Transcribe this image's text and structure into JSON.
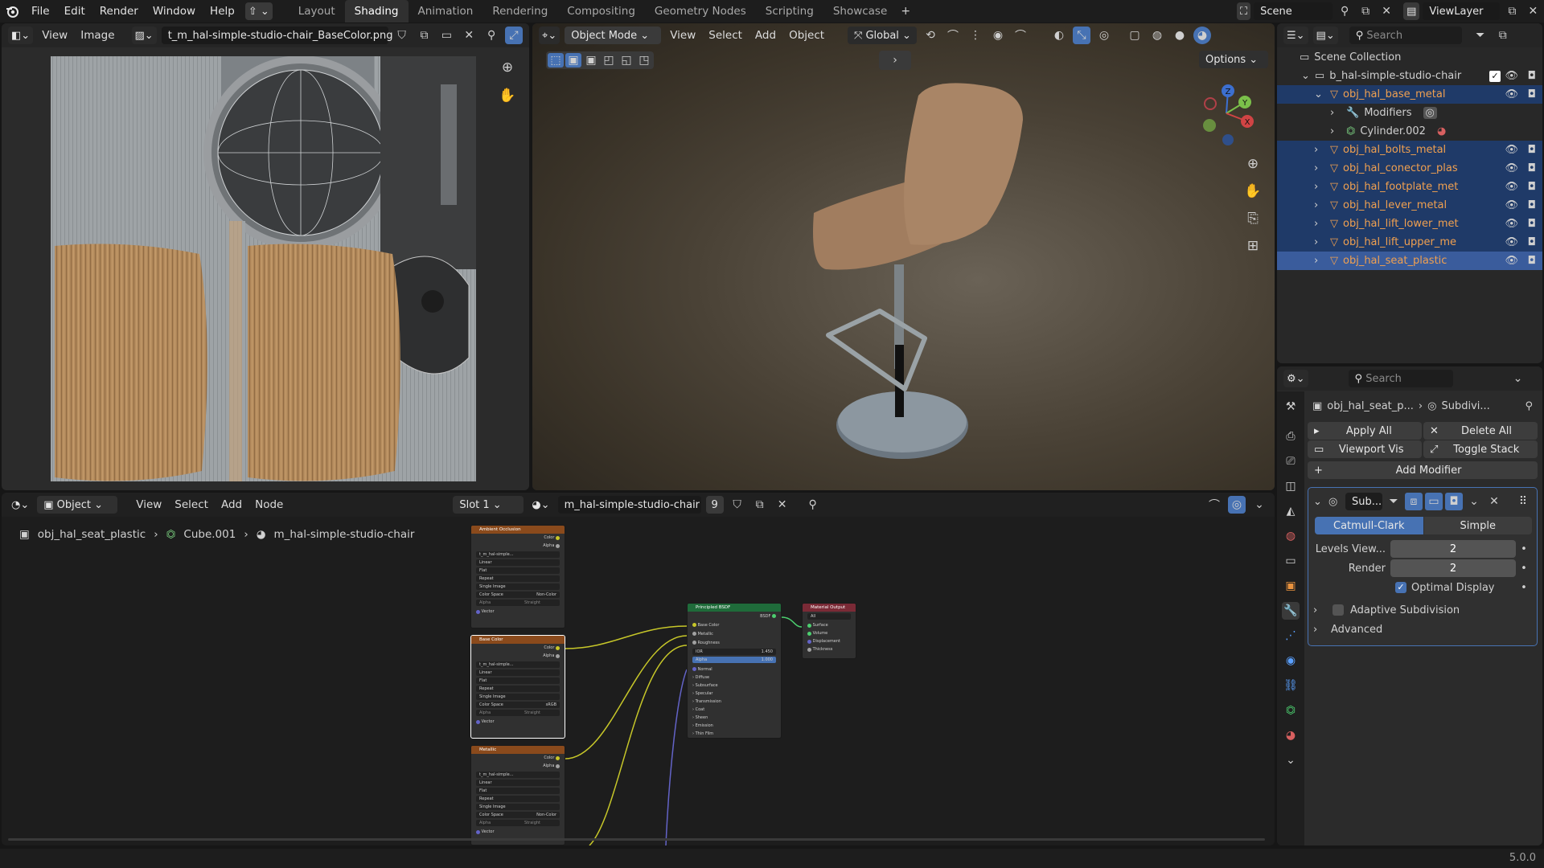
{
  "topbar": {
    "menus": [
      "File",
      "Edit",
      "Render",
      "Window",
      "Help"
    ],
    "workspaces": [
      "Layout",
      "Shading",
      "Animation",
      "Rendering",
      "Compositing",
      "Geometry Nodes",
      "Scripting",
      "Showcase"
    ],
    "active_workspace": "Shading",
    "scene": "Scene",
    "view_layer": "ViewLayer"
  },
  "image_editor": {
    "menus": [
      "View",
      "Image"
    ],
    "image_name": "t_m_hal-simple-studio-chair_BaseColor.png"
  },
  "viewport": {
    "mode": "Object Mode",
    "menus": [
      "View",
      "Select",
      "Add",
      "Object"
    ],
    "transform_orientation": "Global",
    "options_label": "Options",
    "gizmo_axes": [
      "Z",
      "Y",
      "X"
    ]
  },
  "outliner": {
    "search_placeholder": "Search",
    "scene_collection": "Scene Collection",
    "collection": "b_hal-simple-studio-chair",
    "items": [
      {
        "name": "obj_hal_base_metal",
        "level": 1,
        "expanded": true,
        "selected": true
      },
      {
        "name": "Modifiers",
        "level": 2,
        "kind": "modifiers"
      },
      {
        "name": "Cylinder.002",
        "level": 2,
        "kind": "mesh"
      },
      {
        "name": "obj_hal_bolts_metal",
        "level": 1,
        "selected": true
      },
      {
        "name": "obj_hal_conector_plas",
        "level": 1,
        "selected": true
      },
      {
        "name": "obj_hal_footplate_met",
        "level": 1,
        "selected": true
      },
      {
        "name": "obj_hal_lever_metal",
        "level": 1,
        "selected": true
      },
      {
        "name": "obj_hal_lift_lower_met",
        "level": 1,
        "selected": true
      },
      {
        "name": "obj_hal_lift_upper_me",
        "level": 1,
        "selected": true
      },
      {
        "name": "obj_hal_seat_plastic",
        "level": 1,
        "active": true
      }
    ]
  },
  "properties": {
    "search_placeholder": "Search",
    "breadcrumb_object": "obj_hal_seat_p...",
    "breadcrumb_modifier": "Subdivi...",
    "apply_all": "Apply All",
    "delete_all": "Delete All",
    "viewport_vis": "Viewport Vis",
    "toggle_stack": "Toggle Stack",
    "add_modifier": "Add Modifier",
    "modifier_name": "Sub...",
    "catmull_clark": "Catmull-Clark",
    "simple": "Simple",
    "levels_viewport_label": "Levels View...",
    "levels_viewport": "2",
    "render_label": "Render",
    "render_levels": "2",
    "optimal_display": "Optimal Display",
    "adaptive_subdivision": "Adaptive Subdivision",
    "advanced": "Advanced"
  },
  "node_editor": {
    "object_type": "Object",
    "menus": [
      "View",
      "Select",
      "Add",
      "Node"
    ],
    "slot": "Slot 1",
    "material": "m_hal-simple-studio-chair",
    "users": "9",
    "breadcrumb": [
      "obj_hal_seat_plastic",
      "Cube.001",
      "m_hal-simple-studio-chair"
    ],
    "tex_nodes": [
      {
        "title": "Ambient Occlusion",
        "image": "t_m_hal-simple...",
        "colorspace": "Non-Color",
        "alpha": "Straight"
      },
      {
        "title": "Base Color",
        "image": "t_m_hal-simple...",
        "colorspace": "sRGB",
        "alpha": "Straight"
      },
      {
        "title": "Metallic",
        "image": "t_m_hal-simple...",
        "colorspace": "Non-Color",
        "alpha": "Straight"
      }
    ],
    "tex_rows": [
      "Linear",
      "Flat",
      "Repeat",
      "Single Image"
    ],
    "tex_labels": {
      "color": "Color",
      "alpha": "Alpha",
      "colorspace": "Color Space",
      "alpha_mode": "Alpha",
      "vector": "Vector"
    },
    "bsdf": {
      "title": "Principled BSDF",
      "out": "BSDF",
      "inputs": [
        "Base Color",
        "Metallic",
        "Roughness"
      ],
      "ior_label": "IOR",
      "ior": "1.450",
      "alpha_label": "Alpha",
      "alpha": "1.000",
      "normal": "Normal",
      "panels": [
        "Diffuse",
        "Subsurface",
        "Specular",
        "Transmission",
        "Coat",
        "Sheen",
        "Emission",
        "Thin Film"
      ]
    },
    "output": {
      "title": "Material Output",
      "target": "All",
      "inputs": [
        "Surface",
        "Volume",
        "Displacement",
        "Thickness"
      ]
    }
  },
  "statusbar": {
    "version": "5.0.0"
  },
  "colors": {
    "accent": "#4772b3",
    "selected_row": "#1f3a68",
    "active_row": "#3a5c9c",
    "object_name": "#f0a050",
    "tex_header": "#8a4a1c",
    "bsdf_header": "#1f6b3a",
    "output_header": "#7a2a36"
  }
}
